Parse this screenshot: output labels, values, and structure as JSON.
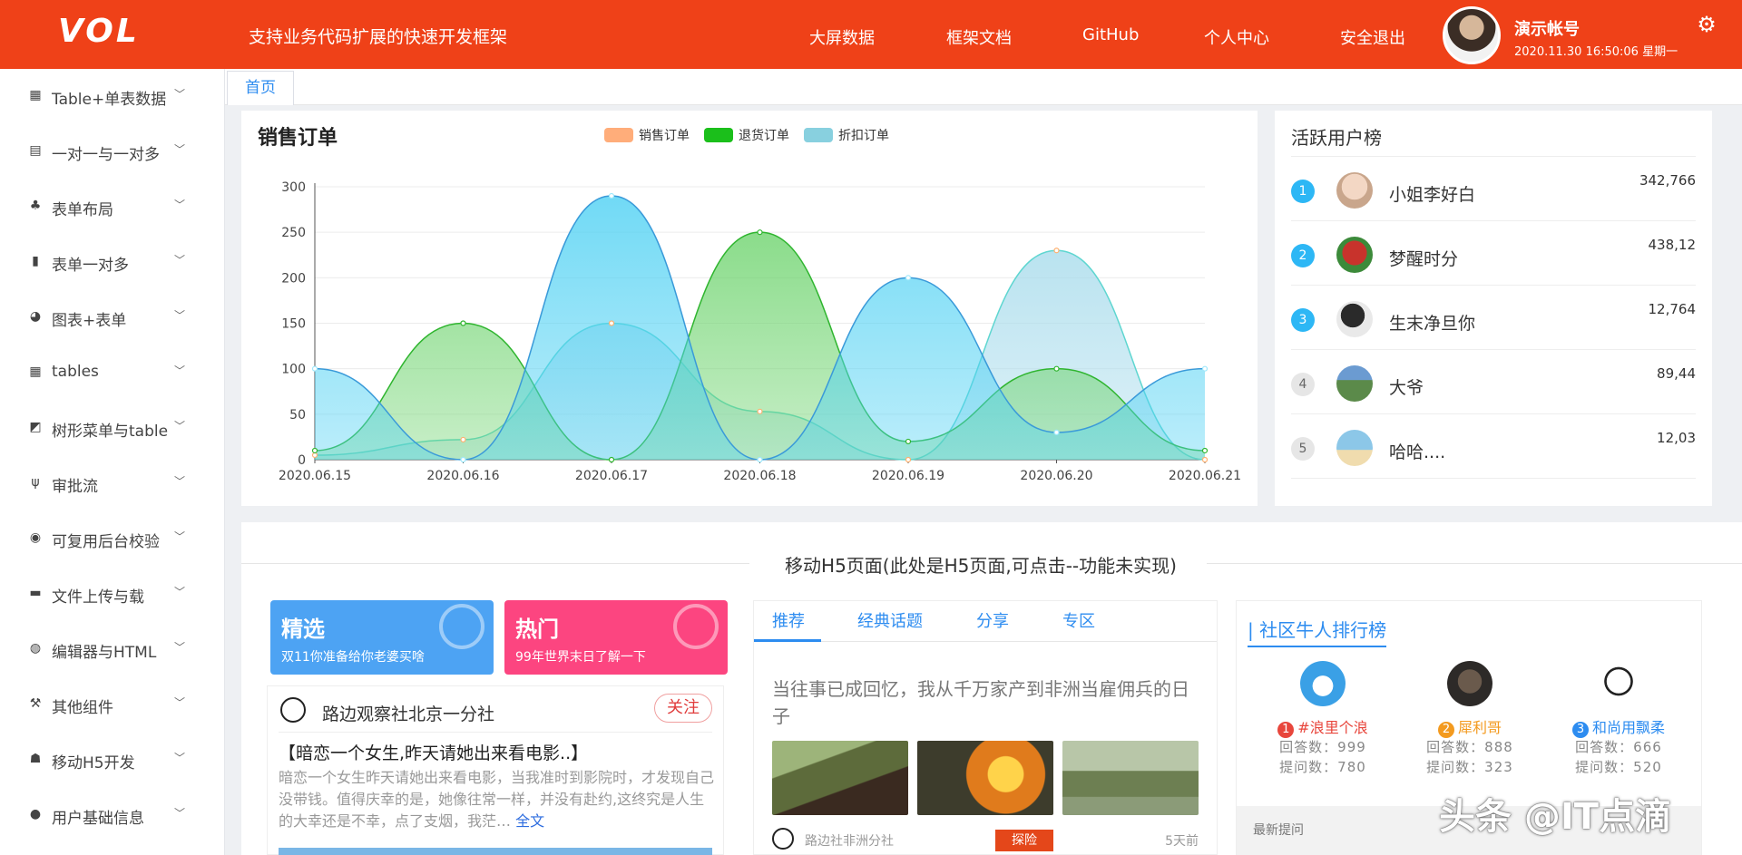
{
  "header": {
    "logo": "VOL",
    "slogan": "支持业务代码扩展的快速开发框架",
    "nav": [
      "大屏数据",
      "框架文档",
      "GitHub",
      "个人中心",
      "安全退出"
    ],
    "account_name": "演示帐号",
    "account_time": "2020.11.30 16:50:06 星期一",
    "settings_icon": "gear-icon",
    "accent_color": "#ef4118"
  },
  "sidebar": {
    "items": [
      {
        "label": "Table+单表数据",
        "icon": "grid-icon"
      },
      {
        "label": "一对一与一对多",
        "icon": "list-icon"
      },
      {
        "label": "表单布局",
        "icon": "cluster-icon"
      },
      {
        "label": "表单一对多",
        "icon": "bar-icon"
      },
      {
        "label": "图表+表单",
        "icon": "pie-icon"
      },
      {
        "label": "tables",
        "icon": "grid-icon"
      },
      {
        "label": "树形菜单与table",
        "icon": "line-chart-icon"
      },
      {
        "label": "审批流",
        "icon": "fork-icon"
      },
      {
        "label": "可复用后台校验",
        "icon": "toggle-icon"
      },
      {
        "label": "文件上传与载",
        "icon": "folder-icon"
      },
      {
        "label": "编辑器与HTML",
        "icon": "compass-icon"
      },
      {
        "label": "其他组件",
        "icon": "hammer-icon"
      },
      {
        "label": "移动H5开发",
        "icon": "android-icon"
      },
      {
        "label": "用户基础信息",
        "icon": "user-icon"
      }
    ]
  },
  "tabs": {
    "home": "首页"
  },
  "chart_panel": {
    "title": "销售订单",
    "legend": [
      {
        "label": "销售订单",
        "color": "#ffad7a"
      },
      {
        "label": "退货订单",
        "color": "#1bbf1b"
      },
      {
        "label": "折扣订单",
        "color": "#88d0df"
      }
    ]
  },
  "chart_data": {
    "type": "area",
    "categories": [
      "2020.06.15",
      "2020.06.16",
      "2020.06.17",
      "2020.06.18",
      "2020.06.19",
      "2020.06.20",
      "2020.06.21"
    ],
    "ylim": [
      0,
      300
    ],
    "yticks": [
      "0",
      "50",
      "100",
      "150",
      "200",
      "250",
      "300"
    ],
    "smooth": true,
    "grid": true,
    "legend_position": "top-center",
    "series": [
      {
        "name": "销售订单",
        "values": [
          5,
          22,
          150,
          53,
          0,
          230,
          0
        ],
        "line": "#5ed6d0",
        "fill": "#a9dcec",
        "dot": "#ffb070"
      },
      {
        "name": "退货订单",
        "values": [
          10,
          150,
          0,
          250,
          20,
          100,
          10
        ],
        "line": "#2fb52f",
        "fill": "#6fd46f",
        "dot": "#2fb52f"
      },
      {
        "name": "折扣订单",
        "values": [
          100,
          0,
          290,
          0,
          200,
          30,
          100
        ],
        "line": "#3a9ad9",
        "fill": "#4fd1f3",
        "dot": "#9ee8fb"
      }
    ]
  },
  "active_users": {
    "title": "活跃用户榜",
    "rows": [
      {
        "rank": "1",
        "name": "小姐李好白",
        "value": "342,766",
        "avatar": "#f3d7c4"
      },
      {
        "rank": "2",
        "name": "梦醒时分",
        "value": "438,12",
        "avatar": "#c8332c"
      },
      {
        "rank": "3",
        "name": "生末净旦你",
        "value": "12,764",
        "avatar": "#2a2a2a"
      },
      {
        "rank": "4",
        "name": "大爷",
        "value": "89,44",
        "avatar": "#5b8a4a"
      },
      {
        "rank": "5",
        "name": "哈哈....",
        "value": "12,03",
        "avatar": "#8cc7e8"
      }
    ]
  },
  "h5": {
    "title": "移动H5页面(此处是H5页面,可点击--功能未实现)",
    "promos": [
      {
        "title": "精选",
        "desc": "双11你准备给你老婆买啥",
        "color": "#4da3f3"
      },
      {
        "title": "热门",
        "desc": "99年世界末日了解一下",
        "color": "#fc4580"
      }
    ],
    "news": {
      "author": "路边观察社北京一分社",
      "follow": "关注",
      "headline": "【暗恋一个女生,昨天请她出来看电影..】",
      "body": "暗恋一个女生昨天请她出来看电影，当我准时到影院时，才发现自己没带钱。值得庆幸的是，她像往常一样，并没有赴约,这终究是人生的大幸还是不幸，点了支烟，我茫…",
      "more": "全文"
    },
    "tabs": [
      "推荐",
      "经典话题",
      "分享",
      "专区"
    ],
    "article": {
      "title": "当往事已成回忆，我从千万家产到非洲当雇佣兵的日子",
      "author": "路边社非洲分社",
      "tag": "探险",
      "time": "5天前"
    },
    "ranking": {
      "title": "| 社区牛人排行榜",
      "people": [
        {
          "num": "1",
          "name": "#浪里个浪",
          "answers": "回答数：999",
          "questions": "提问数：780",
          "color": "#e8463c"
        },
        {
          "num": "2",
          "name": "犀利哥",
          "answers": "回答数：888",
          "questions": "提问数：323",
          "color": "#f39a1f"
        },
        {
          "num": "3",
          "name": "和尚用飘柔",
          "answers": "回答数：666",
          "questions": "提问数：520",
          "color": "#2d8cf0"
        }
      ],
      "latest": "最新提问"
    }
  },
  "watermark": "头条 @IT点滴"
}
